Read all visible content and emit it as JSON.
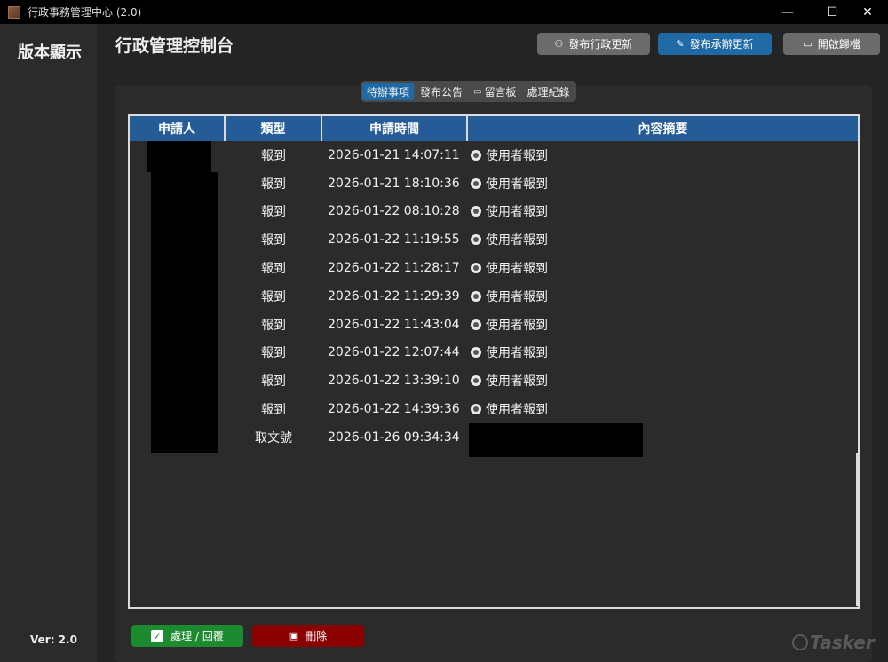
{
  "window": {
    "title": "行政事務管理中心 (2.0)",
    "controls": {
      "minimize": "—",
      "maximize": "☐",
      "close": "✕"
    }
  },
  "sidebar": {
    "title": "版本顯示",
    "version": "Ver: 2.0"
  },
  "header": {
    "title": "行政管理控制台",
    "buttons": {
      "publish_admin": "發布行政更新",
      "publish_handler": "發布承辦更新",
      "open_archive": "開啟歸檔"
    }
  },
  "tabs": [
    {
      "label": "待辦事項",
      "active": true
    },
    {
      "label": "發布公告",
      "active": false
    },
    {
      "label": "留言板",
      "active": false
    },
    {
      "label": "處理紀錄",
      "active": false
    }
  ],
  "table": {
    "columns": [
      "申請人",
      "類型",
      "申請時間",
      "內容摘要"
    ],
    "rows": [
      {
        "type": "報到",
        "time": "2026-01-21 14:07:11",
        "summary": "使用者報到"
      },
      {
        "type": "報到",
        "time": "2026-01-21 18:10:36",
        "summary": "使用者報到"
      },
      {
        "type": "報到",
        "time": "2026-01-22 08:10:28",
        "summary": "使用者報到"
      },
      {
        "type": "報到",
        "time": "2026-01-22 11:19:55",
        "summary": "使用者報到"
      },
      {
        "type": "報到",
        "time": "2026-01-22 11:28:17",
        "summary": "使用者報到"
      },
      {
        "type": "報到",
        "time": "2026-01-22 11:29:39",
        "summary": "使用者報到"
      },
      {
        "type": "報到",
        "time": "2026-01-22 11:43:04",
        "summary": "使用者報到"
      },
      {
        "type": "報到",
        "time": "2026-01-22 12:07:44",
        "summary": "使用者報到"
      },
      {
        "type": "報到",
        "time": "2026-01-22 13:39:10",
        "summary": "使用者報到"
      },
      {
        "type": "報到",
        "time": "2026-01-22 14:39:36",
        "summary": "使用者報到"
      },
      {
        "type": "取文號",
        "time": "2026-01-26 09:34:34",
        "summary": ""
      }
    ]
  },
  "actions": {
    "process_reply": "處理 / 回覆",
    "delete": "刪除"
  },
  "watermark": "Tasker",
  "colors": {
    "accent_blue": "#1f6aa5",
    "header_blue": "#255b96",
    "green": "#1c8a2e",
    "red": "#8b0000",
    "gray_button": "#6b6b6b"
  }
}
